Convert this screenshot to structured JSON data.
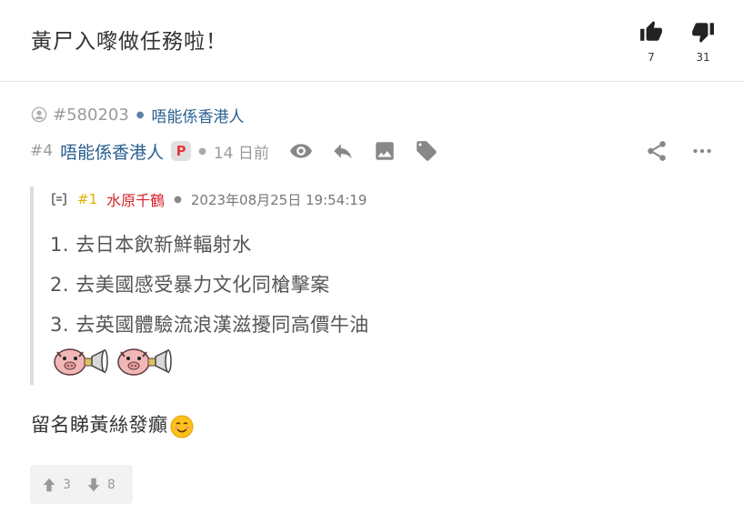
{
  "thread": {
    "title": "黃尸入嚟做任務啦！",
    "upvotes": "7",
    "downvotes": "31"
  },
  "post": {
    "id_text": "#580203",
    "header_author": "唔能係香港人",
    "floor": "#4",
    "author": "唔能係香港人",
    "badge": "P",
    "time_ago": "14 日前",
    "quote": {
      "floor": "#1",
      "author": "水原千鶴",
      "timestamp": "2023年08月25日 19:54:19",
      "lines": [
        "1. 去日本飲新鮮輻射水",
        "2. 去美國感受暴力文化同槍擊案",
        "3. 去英國體驗流浪漢滋擾同高價牛油"
      ]
    },
    "reply": "留名睇黃絲發癲",
    "upvotes": "3",
    "downvotes": "8"
  },
  "colors": {
    "link": "#2a5f8f",
    "quote_author": "#d4232a",
    "quote_floor": "#e0b000",
    "badge_text": "#e8383d"
  },
  "icons": [
    "thumbs-up-icon",
    "thumbs-down-icon",
    "user-icon",
    "eye-icon",
    "reply-icon",
    "image-icon",
    "tag-icon",
    "share-icon",
    "more-icon",
    "quote-icon",
    "arrow-up-icon",
    "arrow-down-icon",
    "pig-sticker",
    "smile-emoji"
  ]
}
